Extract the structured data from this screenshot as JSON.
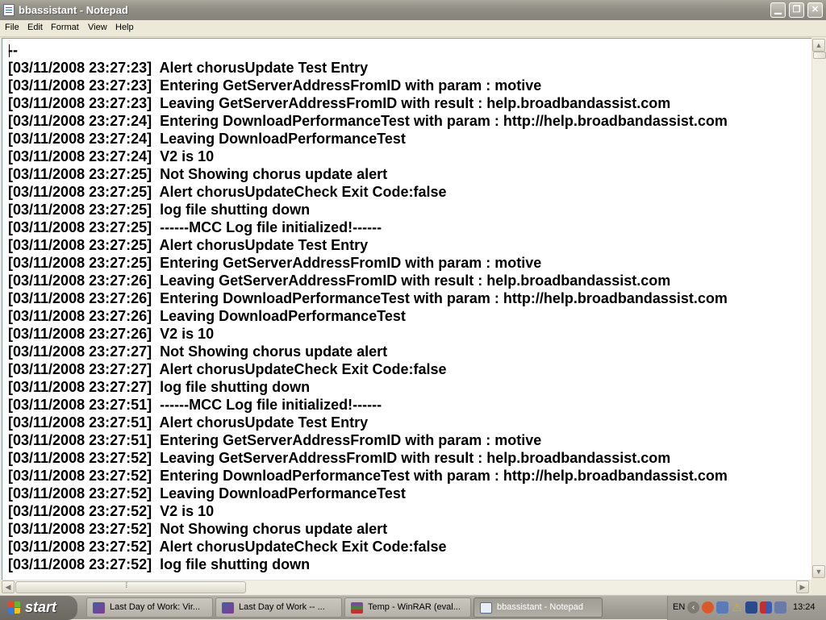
{
  "window": {
    "title": "bbassistant - Notepad"
  },
  "title_buttons": {
    "minimize": "▁",
    "maximize": "❐",
    "close": "✕"
  },
  "menu": [
    "File",
    "Edit",
    "Format",
    "View",
    "Help"
  ],
  "editor": {
    "lines": [
      "--",
      "[03/11/2008 23:27:23]  Alert chorusUpdate Test Entry",
      "[03/11/2008 23:27:23]  Entering GetServerAddressFromID with param : motive",
      "[03/11/2008 23:27:23]  Leaving GetServerAddressFromID with result : help.broadbandassist.com",
      "[03/11/2008 23:27:24]  Entering DownloadPerformanceTest with param : http://help.broadbandassist.com",
      "[03/11/2008 23:27:24]  Leaving DownloadPerformanceTest",
      "[03/11/2008 23:27:24]  V2 is 10",
      "[03/11/2008 23:27:25]  Not Showing chorus update alert",
      "[03/11/2008 23:27:25]  Alert chorusUpdateCheck Exit Code:false",
      "[03/11/2008 23:27:25]  log file shutting down",
      "[03/11/2008 23:27:25]  ------MCC Log file initialized!------",
      "[03/11/2008 23:27:25]  Alert chorusUpdate Test Entry",
      "[03/11/2008 23:27:25]  Entering GetServerAddressFromID with param : motive",
      "[03/11/2008 23:27:26]  Leaving GetServerAddressFromID with result : help.broadbandassist.com",
      "[03/11/2008 23:27:26]  Entering DownloadPerformanceTest with param : http://help.broadbandassist.com",
      "[03/11/2008 23:27:26]  Leaving DownloadPerformanceTest",
      "[03/11/2008 23:27:26]  V2 is 10",
      "[03/11/2008 23:27:27]  Not Showing chorus update alert",
      "[03/11/2008 23:27:27]  Alert chorusUpdateCheck Exit Code:false",
      "[03/11/2008 23:27:27]  log file shutting down",
      "[03/11/2008 23:27:51]  ------MCC Log file initialized!------",
      "[03/11/2008 23:27:51]  Alert chorusUpdate Test Entry",
      "[03/11/2008 23:27:51]  Entering GetServerAddressFromID with param : motive",
      "[03/11/2008 23:27:52]  Leaving GetServerAddressFromID with result : help.broadbandassist.com",
      "[03/11/2008 23:27:52]  Entering DownloadPerformanceTest with param : http://help.broadbandassist.com",
      "[03/11/2008 23:27:52]  Leaving DownloadPerformanceTest",
      "[03/11/2008 23:27:52]  V2 is 10",
      "[03/11/2008 23:27:52]  Not Showing chorus update alert",
      "[03/11/2008 23:27:52]  Alert chorusUpdateCheck Exit Code:false",
      "[03/11/2008 23:27:52]  log file shutting down"
    ]
  },
  "taskbar": {
    "start_label": "start",
    "tasks": [
      {
        "label": "Last Day of Work: Vir...",
        "icon": "browser-icon",
        "active": false
      },
      {
        "label": "Last Day of Work -- ...",
        "icon": "browser-icon",
        "active": false
      },
      {
        "label": "Temp - WinRAR (eval...",
        "icon": "winrar-icon",
        "active": false
      },
      {
        "label": "bbassistant - Notepad",
        "icon": "notepad-icon",
        "active": true
      }
    ],
    "tray": {
      "language": "EN",
      "clock": "13:24"
    }
  }
}
